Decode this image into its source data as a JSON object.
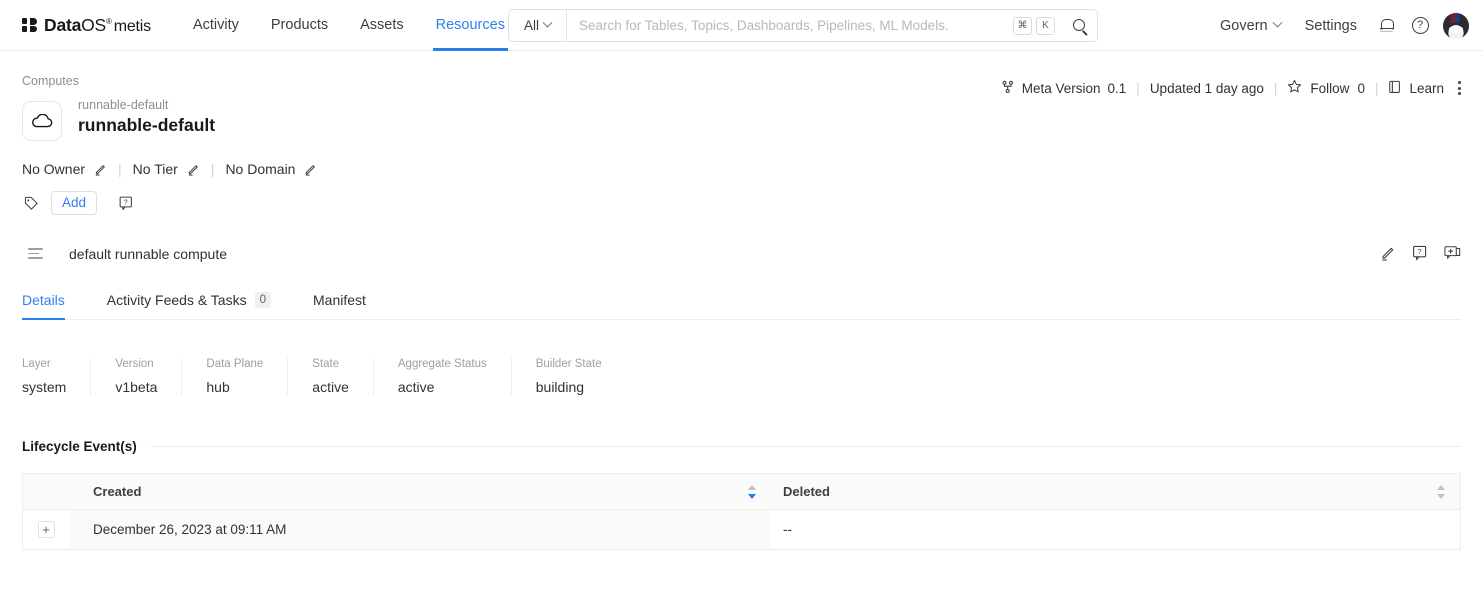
{
  "topbar": {
    "brand": {
      "bold": "Data",
      "regular": "OS",
      "registered": "®",
      "product": "metis"
    },
    "nav": [
      {
        "label": "Activity",
        "active": false
      },
      {
        "label": "Products",
        "active": false
      },
      {
        "label": "Assets",
        "active": false
      },
      {
        "label": "Resources",
        "active": true
      }
    ],
    "search": {
      "scope": "All",
      "placeholder": "Search for Tables, Topics, Dashboards, Pipelines, ML Models.",
      "value": "",
      "shortcut_meta": "⌘",
      "shortcut_key": "K"
    },
    "govern_label": "Govern",
    "settings_label": "Settings"
  },
  "entity": {
    "breadcrumb": "Computes",
    "sub_name": "runnable-default",
    "title": "runnable-default",
    "owner": "No Owner",
    "tier": "No Tier",
    "domain": "No Domain",
    "add_tag_label": "Add",
    "meta": {
      "meta_version_label": "Meta Version",
      "meta_version_value": "0.1",
      "updated": "Updated 1 day ago",
      "follow_label": "Follow",
      "follow_count": "0",
      "learn_label": "Learn"
    },
    "description": "default runnable compute"
  },
  "tabs": [
    {
      "label": "Details",
      "badge": "",
      "active": true
    },
    {
      "label": "Activity Feeds & Tasks",
      "badge": "0",
      "active": false
    },
    {
      "label": "Manifest",
      "badge": "",
      "active": false
    }
  ],
  "stats": [
    {
      "label": "Layer",
      "value": "system"
    },
    {
      "label": "Version",
      "value": "v1beta"
    },
    {
      "label": "Data Plane",
      "value": "hub"
    },
    {
      "label": "State",
      "value": "active"
    },
    {
      "label": "Aggregate Status",
      "value": "active"
    },
    {
      "label": "Builder State",
      "value": "building"
    }
  ],
  "lifecycle": {
    "section_title": "Lifecycle Event(s)",
    "columns": [
      "Created",
      "Deleted"
    ],
    "rows": [
      {
        "expander": "+",
        "created": "December 26, 2023 at 09:11 AM",
        "deleted": "--"
      }
    ]
  },
  "colors": {
    "accent": "#2680eb",
    "link": "#2f80ed",
    "text": "#2e3338",
    "muted": "#9aa0a6",
    "border": "#ededed",
    "row_tint": "#fafafa"
  }
}
